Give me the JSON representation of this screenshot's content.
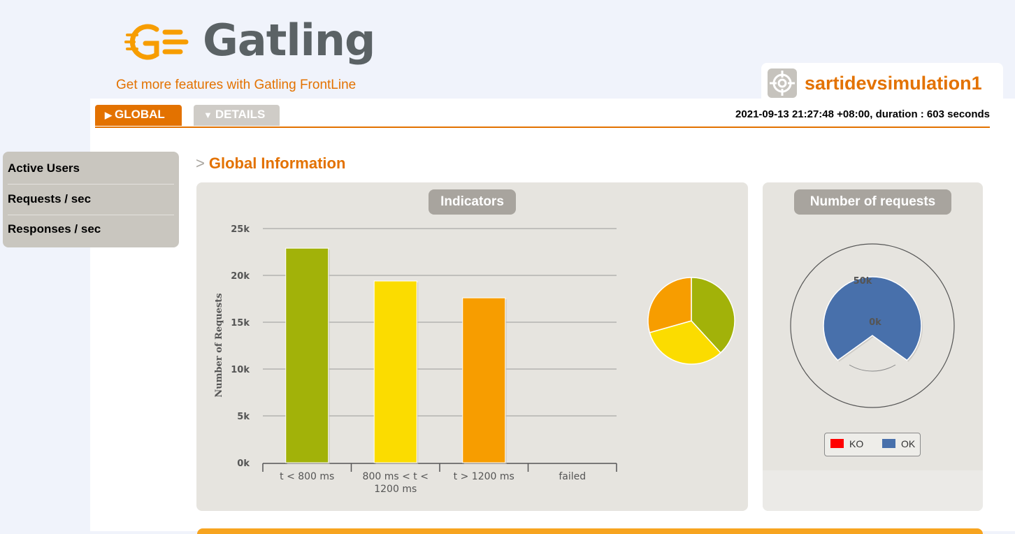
{
  "header": {
    "logo_text": "Gatling",
    "frontline_link": "Get more features with Gatling FrontLine",
    "simulation_name": "sartidevsimulation1"
  },
  "tabs": [
    {
      "label": "GLOBAL",
      "active": true
    },
    {
      "label": "DETAILS",
      "active": false
    }
  ],
  "run_info": "2021-09-13 21:27:48 +08:00, duration : 603 seconds",
  "sidebar": {
    "items": [
      {
        "label": "Active Users"
      },
      {
        "label": "Requests / sec"
      },
      {
        "label": "Responses / sec"
      }
    ]
  },
  "section_title": "Global Information",
  "indicators": {
    "title": "Indicators"
  },
  "number_of_requests": {
    "title": "Number of requests"
  },
  "colors": {
    "accent": "#e37200",
    "green": "#a2b209",
    "yellow": "#fbdc00",
    "orange": "#f79d00",
    "blue": "#4870ab",
    "red": "#ff0000"
  },
  "chart_data": [
    {
      "type": "bar",
      "ylabel": "Number of Requests",
      "xlabel": "",
      "categories": [
        "t < 800 ms",
        "800 ms < t < 1200 ms",
        "t > 1200 ms",
        "failed"
      ],
      "category_lines": [
        [
          "t < 800 ms"
        ],
        [
          "800 ms < t <",
          "1200 ms"
        ],
        [
          "t > 1200 ms"
        ],
        [
          "failed"
        ]
      ],
      "values": [
        22900,
        19400,
        17600,
        0
      ],
      "colors": [
        "#a2b209",
        "#fbdc00",
        "#f79d00",
        "#ff0000"
      ],
      "ylim": [
        0,
        25000
      ],
      "yticks": [
        0,
        5000,
        10000,
        15000,
        20000,
        25000
      ],
      "ytick_labels": [
        "0k",
        "5k",
        "10k",
        "15k",
        "20k",
        "25k"
      ],
      "grid": true
    },
    {
      "type": "pie",
      "categories": [
        "t < 800 ms",
        "800 ms < t < 1200 ms",
        "t > 1200 ms",
        "failed"
      ],
      "values": [
        22900,
        19400,
        17600,
        0
      ],
      "colors": [
        "#a2b209",
        "#fbdc00",
        "#f79d00",
        "#ff0000"
      ]
    },
    {
      "type": "pie",
      "subtype": "gauge",
      "series": [
        {
          "name": "KO",
          "value": 0,
          "color": "#ff0000"
        },
        {
          "name": "OK",
          "value": 59900,
          "color": "#4870ab"
        }
      ],
      "tick_labels": [
        "0k",
        "50k"
      ],
      "legend": "bottom"
    }
  ]
}
